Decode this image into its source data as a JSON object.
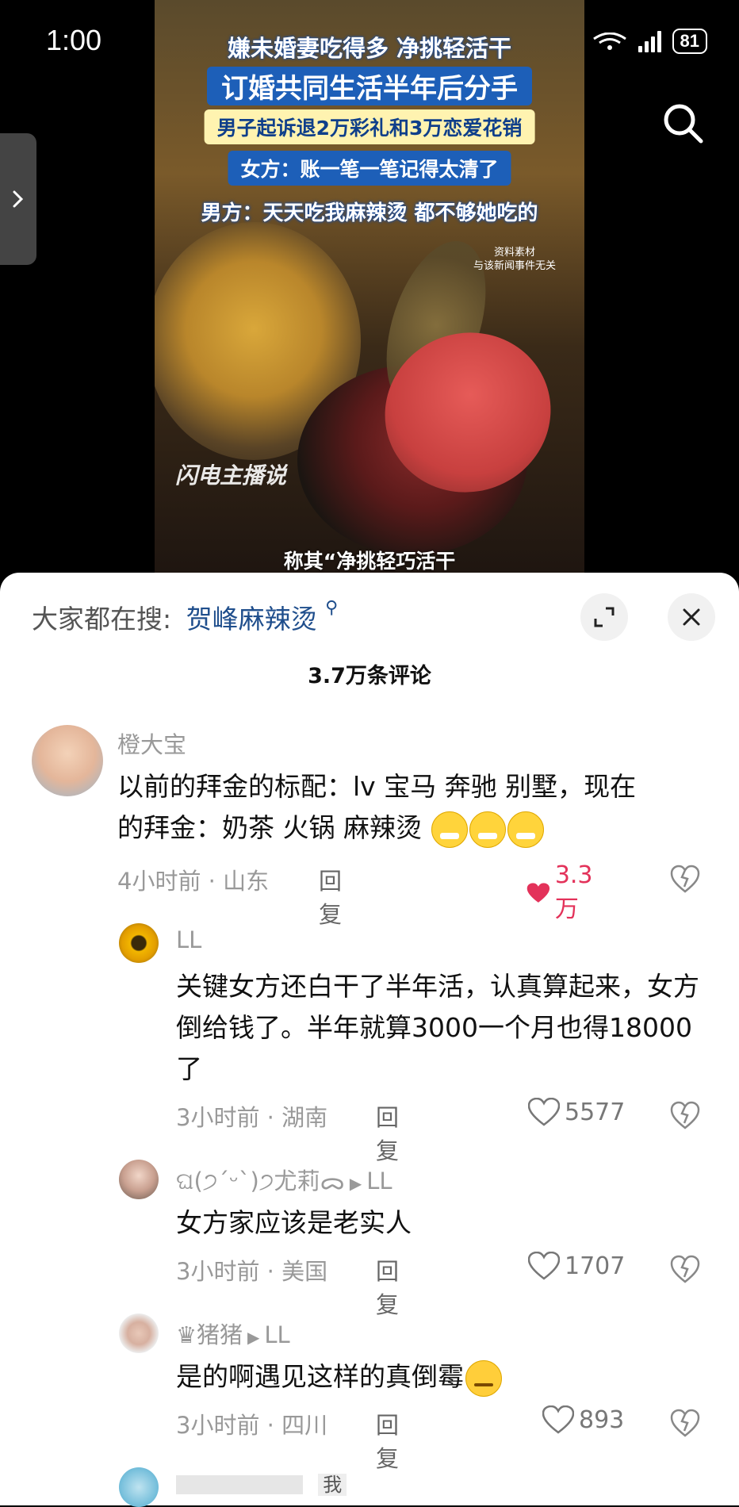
{
  "status_bar": {
    "time": "1:00",
    "battery": "81"
  },
  "video": {
    "caption_lines": [
      "嫌未婚妻吃得多 净挑轻活干",
      "订婚共同生活半年后分手",
      "男子起诉退2万彩礼和3万恋爱花销",
      "女方：账一笔一笔记得太清了",
      "男方：天天吃我麻辣烫 都不够她吃的"
    ],
    "note_lines": [
      "资料素材",
      "与该新闻事件无关"
    ],
    "watermark": "闪电主播说",
    "subtitle": "称其“净挑轻巧活干"
  },
  "sheet": {
    "hot_search_label": "大家都在搜:",
    "hot_search_keyword": "贺峰麻辣烫",
    "comment_count": "3.7万条评论",
    "comments": [
      {
        "user": "橙大宝",
        "text_line1": "以前的拜金的标配：lv 宝马 奔驰 别墅，现在",
        "text_line2": "的拜金：奶茶 火锅 麻辣烫",
        "time": "4小时前",
        "location": "山东",
        "reply": "回复",
        "likes": "3.3万",
        "liked": true
      },
      {
        "user": "LL",
        "text": "关键女方还白干了半年活，认真算起来，女方倒给钱了。半年就算3000一个月也得18000了",
        "time": "3小时前",
        "location": "湖南",
        "reply": "回复",
        "likes": "5577"
      },
      {
        "user": "ଘ(੭ˊᵕˋ)੭尤莉ᯅ",
        "reply_to": "LL",
        "text": "女方家应该是老实人",
        "time": "3小时前",
        "location": "美国",
        "reply": "回复",
        "likes": "1707"
      },
      {
        "user": "♛猪猪",
        "reply_to": "LL",
        "text": "是的啊遇见这样的真倒霉",
        "time": "3小时前",
        "location": "四川",
        "reply": "回复",
        "likes": "893"
      },
      {
        "user": "",
        "reply_to": "我"
      }
    ]
  },
  "colors": {
    "like_red": "#e3325a",
    "link_blue": "#1f4e8c",
    "caption_blue": "#1d5fb8"
  },
  "icons": [
    "search-icon",
    "chevron-right-icon",
    "expand-icon",
    "close-icon",
    "heart-icon",
    "dislike-icon"
  ]
}
